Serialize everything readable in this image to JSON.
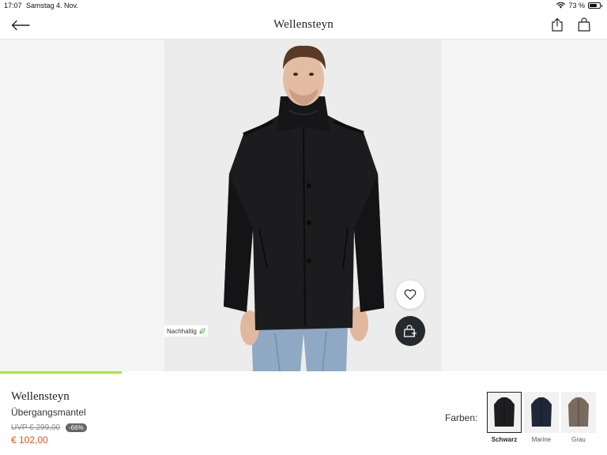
{
  "status": {
    "time": "17:07",
    "date": "Samstag 4. Nov.",
    "battery": "73 %",
    "battery_level": 0.73
  },
  "nav": {
    "title": "Wellensteyn",
    "back_icon": "arrow-left-icon",
    "share_icon": "share-icon",
    "bag_icon": "shopping-bag-icon"
  },
  "gallery": {
    "badge": "Nachhaltig",
    "badge_icon": "leaf-icon",
    "wishlist_icon": "heart-icon",
    "cart_icon": "add-to-bag-icon",
    "progress": 0.2
  },
  "product": {
    "brand": "Wellensteyn",
    "name": "Übergangsmantel",
    "uvp": "UVP € 299,00",
    "discount": "-66%",
    "price": "€ 102,00"
  },
  "colors": {
    "label": "Farben:",
    "options": [
      {
        "name": "Schwarz",
        "color": "#1e1e20",
        "selected": true
      },
      {
        "name": "Marine",
        "color": "#1f2738",
        "selected": false
      },
      {
        "name": "Grau",
        "color": "#7a6b60",
        "selected": false
      }
    ]
  },
  "accent_colors": {
    "price": "#e8561c",
    "progress": "#a8e63c",
    "cart_button": "#252a2e"
  }
}
